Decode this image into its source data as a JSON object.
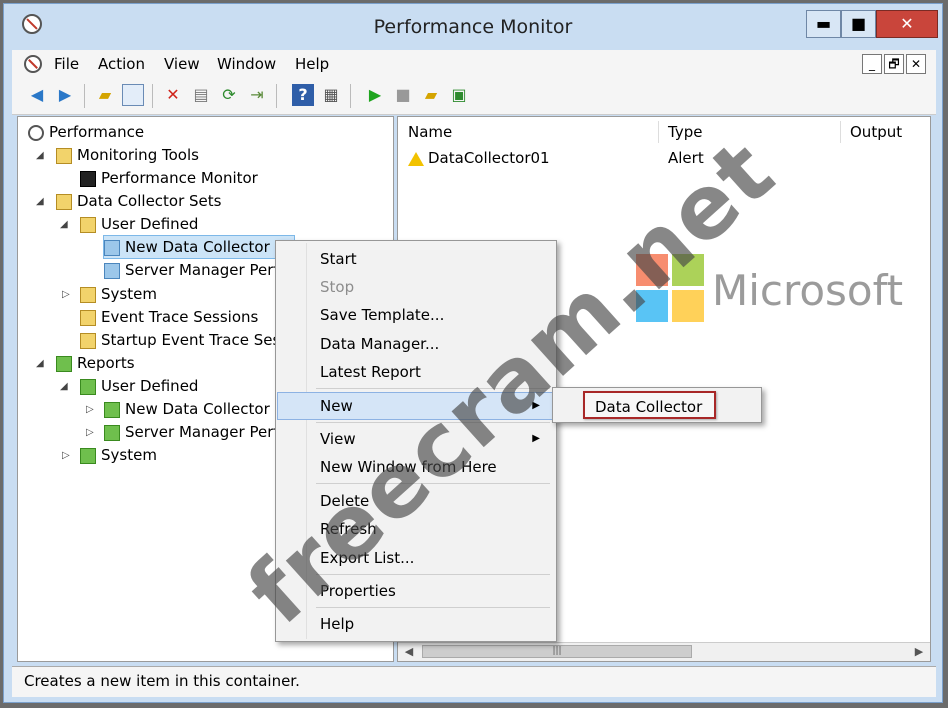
{
  "window": {
    "title": "Performance Monitor",
    "min": "▬",
    "max": "■",
    "close": "✕"
  },
  "menu": {
    "items": [
      "File",
      "Action",
      "View",
      "Window",
      "Help"
    ],
    "mdi_min": "_",
    "mdi_restore": "🗗",
    "mdi_close": "✕"
  },
  "tree": {
    "root": "Performance",
    "monitoring_tools": "Monitoring Tools",
    "performance_monitor": "Performance Monitor",
    "data_collector_sets": "Data Collector Sets",
    "user_defined": "User Defined",
    "new_dcs": "New Data Collector Se",
    "server_manager": "Server Manager Perfo",
    "system": "System",
    "event_trace": "Event Trace Sessions",
    "startup_trace": "Startup Event Trace Sessic",
    "reports": "Reports",
    "r_user_defined": "User Defined",
    "r_new_dcs": "New Data Collector Se",
    "r_server_manager": "Server Manager Perfor",
    "r_system": "System"
  },
  "list": {
    "columns": [
      "Name",
      "Type",
      "Output"
    ],
    "rows": [
      {
        "name": "DataCollector01",
        "type": "Alert"
      }
    ]
  },
  "context_menu": {
    "start": "Start",
    "stop": "Stop",
    "save_template": "Save Template...",
    "data_manager": "Data Manager...",
    "latest_report": "Latest Report",
    "new": "New",
    "view": "View",
    "new_window": "New Window from Here",
    "delete": "Delete",
    "refresh": "Refresh",
    "export_list": "Export List...",
    "properties": "Properties",
    "help": "Help"
  },
  "submenu": {
    "data_collector": "Data Collector"
  },
  "status": {
    "text": "Creates a new item in this container."
  },
  "branding": {
    "microsoft": "Microsoft",
    "watermark": "freecram.net"
  },
  "colors": {
    "ms_red": "#f25022",
    "ms_green": "#7fba00",
    "ms_blue": "#00a4ef",
    "ms_yellow": "#ffb900",
    "highlight_border": "#a82828"
  }
}
